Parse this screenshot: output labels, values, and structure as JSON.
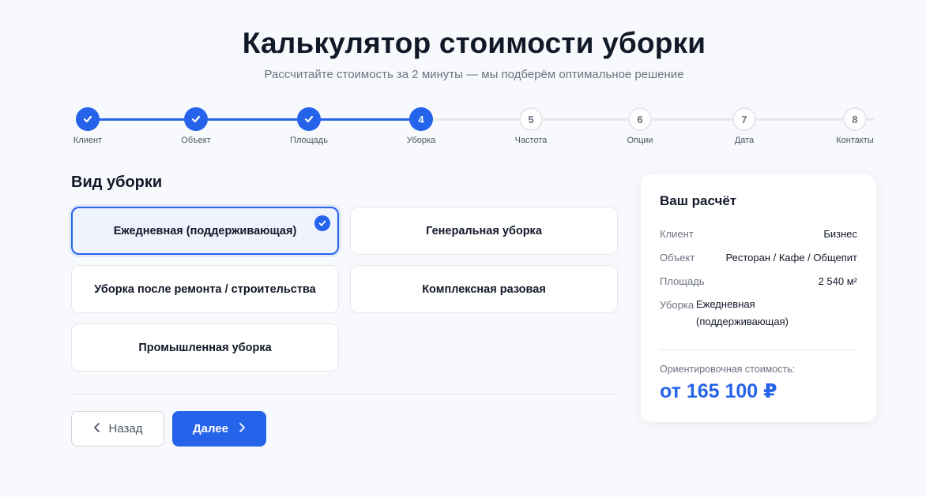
{
  "header": {
    "title": "Калькулятор стоимости уборки",
    "subtitle": "Рассчитайте стоимость за 2 минуты — мы подберём оптимальное решение"
  },
  "stepper": {
    "current_step": 4,
    "steps": [
      {
        "number": "1",
        "label": "Клиент",
        "state": "done"
      },
      {
        "number": "2",
        "label": "Объект",
        "state": "done"
      },
      {
        "number": "3",
        "label": "Площадь",
        "state": "done"
      },
      {
        "number": "4",
        "label": "Уборка",
        "state": "active"
      },
      {
        "number": "5",
        "label": "Частота",
        "state": "pending"
      },
      {
        "number": "6",
        "label": "Опции",
        "state": "pending"
      },
      {
        "number": "7",
        "label": "Дата",
        "state": "pending"
      },
      {
        "number": "8",
        "label": "Контакты",
        "state": "pending"
      }
    ]
  },
  "section": {
    "title": "Вид уборки",
    "options": [
      {
        "label": "Ежедневная (поддерживающая)",
        "selected": true
      },
      {
        "label": "Генеральная уборка",
        "selected": false
      },
      {
        "label": "Уборка после ремонта / строительства",
        "selected": false
      },
      {
        "label": "Комплексная разовая",
        "selected": false
      },
      {
        "label": "Промышленная уборка",
        "selected": false
      }
    ]
  },
  "nav": {
    "back_label": "Назад",
    "next_label": "Далее"
  },
  "summary": {
    "title": "Ваш расчёт",
    "rows": [
      {
        "key": "Клиент",
        "value": "Бизнес"
      },
      {
        "key": "Объект",
        "value": "Ресторан / Кафе / Общепит"
      },
      {
        "key": "Площадь",
        "value": "2 540 м²"
      },
      {
        "key": "Уборка",
        "value": "Ежедневная (поддерживающая)"
      }
    ],
    "estimate_label": "Ориентировочная стоимость:",
    "estimate_value": "от 165 100 ₽"
  },
  "colors": {
    "accent": "#2563eb",
    "background": "#f7f9fc",
    "text": "#111827",
    "muted": "#6b7280"
  }
}
